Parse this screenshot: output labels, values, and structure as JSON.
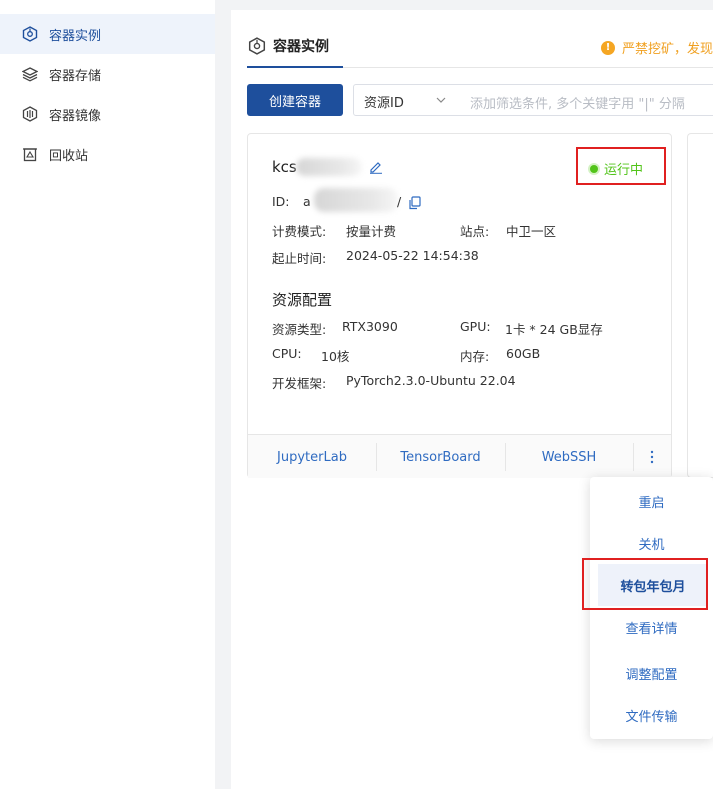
{
  "sidebar": {
    "items": [
      {
        "label": "容器实例",
        "icon": "cluster-icon"
      },
      {
        "label": "容器存储",
        "icon": "layers-icon"
      },
      {
        "label": "容器镜像",
        "icon": "disk-icon"
      },
      {
        "label": "回收站",
        "icon": "trash-icon"
      }
    ]
  },
  "main": {
    "tab_label": "容器实例",
    "warning_text": "严禁挖矿，发现一",
    "create_button": "创建容器",
    "filter": {
      "select_value": "资源ID",
      "placeholder": "添加筛选条件, 多个关键字用 \"|\" 分隔"
    }
  },
  "card": {
    "name_prefix": "kcs",
    "id_label": "ID:",
    "id_prefix": "a",
    "id_suffix": "/",
    "status": "运行中",
    "billing_label": "计费模式:",
    "billing_value": "按量计费",
    "site_label": "站点:",
    "site_value": "中卫一区",
    "time_label": "起止时间:",
    "time_value": "2024-05-22 14:54:38",
    "section_title": "资源配置",
    "resource_type_label": "资源类型:",
    "resource_type_value": "RTX3090",
    "gpu_label": "GPU:",
    "gpu_value": "1卡 * 24 GB显存",
    "cpu_label": "CPU:",
    "cpu_value": "10核",
    "memory_label": "内存:",
    "memory_value": "60GB",
    "framework_label": "开发框架:",
    "framework_value": "PyTorch2.3.0-Ubuntu 22.04",
    "footer": [
      "JupyterLab",
      "TensorBoard",
      "WebSSH"
    ]
  },
  "dropdown": {
    "items": [
      "重启",
      "关机",
      "转包年包月",
      "查看详情",
      "调整配置",
      "文件传输"
    ]
  },
  "colors": {
    "primary": "#1e4f9c",
    "link": "#2f6bc1",
    "running": "#52c41a",
    "warning": "#f0a020",
    "highlight_border": "#e02020"
  }
}
